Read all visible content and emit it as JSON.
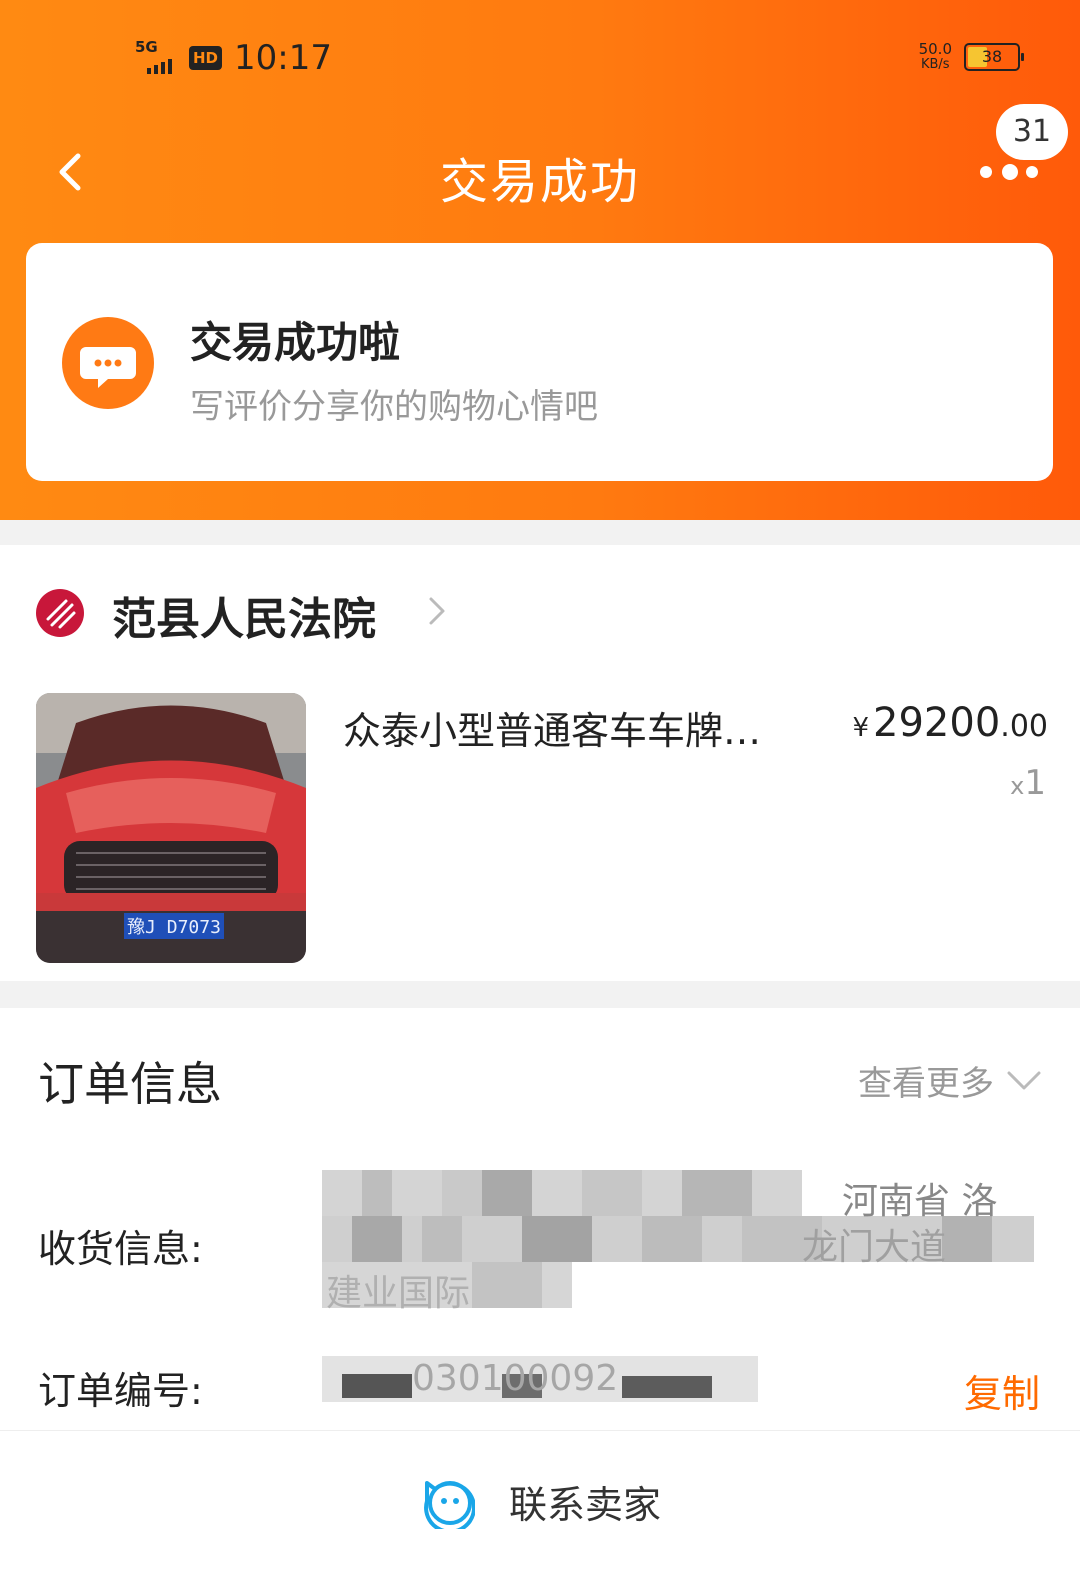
{
  "status_bar": {
    "network": "5G",
    "hd": "HD",
    "time": "10:17",
    "speed_value": "50.0",
    "speed_unit": "KB/s",
    "battery": "38"
  },
  "nav": {
    "title": "交易成功",
    "badge_count": "31",
    "icons": {
      "back": "chevron-left-icon",
      "more": "more-dots-icon"
    }
  },
  "success_card": {
    "title": "交易成功啦",
    "subtitle": "写评价分享你的购物心情吧",
    "icon": "chat-bubble-icon"
  },
  "shop": {
    "name": "范县人民法院",
    "icon": "court-logo-icon"
  },
  "product": {
    "title": "众泰小型普通客车车牌…",
    "currency": "¥",
    "price_int": "29200",
    "price_dec": ".00",
    "qty_prefix": "x",
    "qty": "1",
    "plate_text": "豫J D7073"
  },
  "order_info": {
    "title": "订单信息",
    "view_more": "查看更多",
    "shipping_label": "收货信息:",
    "shipping_visible_1": "河南省 洛",
    "shipping_visible_2": "龙门大道",
    "shipping_visible_3": "建业国际",
    "order_no_label": "订单编号:",
    "order_no_visible": "030100092",
    "copy_label": "复制"
  },
  "bottom": {
    "contact_label": "联系卖家",
    "icon": "contact-seller-icon"
  },
  "colors": {
    "accent": "#ff7a10",
    "copy": "#ff6a00",
    "contact_icon": "#1aa6e8"
  }
}
